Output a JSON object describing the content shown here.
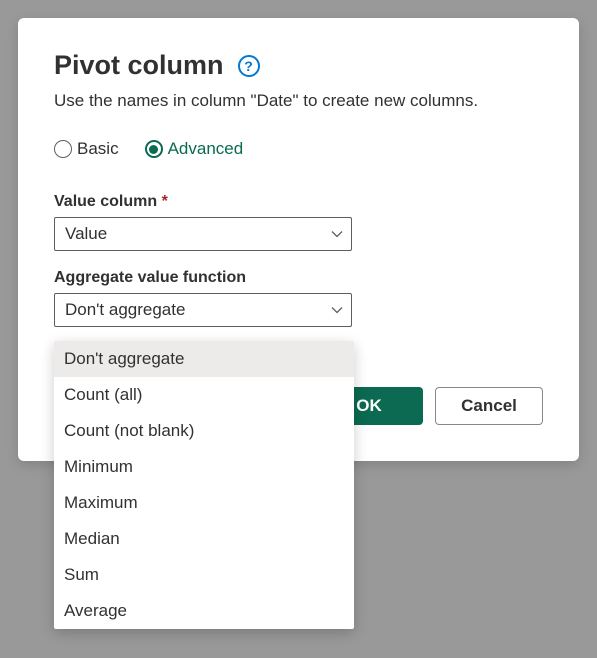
{
  "dialog": {
    "title": "Pivot column",
    "subtitle": "Use the names in column \"Date\" to create new columns.",
    "help_icon": "?"
  },
  "mode": {
    "basic_label": "Basic",
    "advanced_label": "Advanced",
    "selected": "advanced"
  },
  "value_column": {
    "label": "Value column",
    "required": "*",
    "selected": "Value"
  },
  "aggregate": {
    "label": "Aggregate value function",
    "selected": "Don't aggregate",
    "options": [
      "Don't aggregate",
      "Count (all)",
      "Count (not blank)",
      "Minimum",
      "Maximum",
      "Median",
      "Sum",
      "Average"
    ]
  },
  "buttons": {
    "ok": "OK",
    "cancel": "Cancel"
  }
}
